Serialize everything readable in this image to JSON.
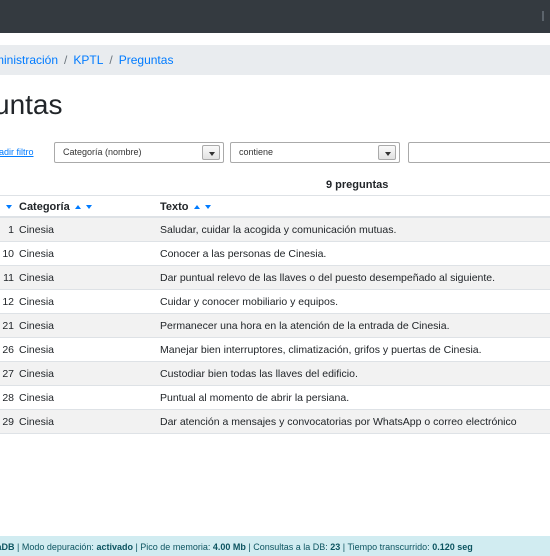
{
  "breadcrumb": {
    "items": [
      "ministración",
      "KPTL",
      "Preguntas"
    ],
    "separator": "/"
  },
  "page_title": "untas",
  "filters": {
    "add_filter_label": "ñadir filtro",
    "field_select": "Categoría (nombre)",
    "operator_select": "contiene",
    "value": ""
  },
  "result_count": "9 preguntas",
  "table": {
    "headers": {
      "categoria": "Categoría",
      "texto": "Texto"
    },
    "rows": [
      {
        "id": "1",
        "categoria": "Cinesia",
        "texto": "Saludar, cuidar la acogida y comunicación mutuas."
      },
      {
        "id": "10",
        "categoria": "Cinesia",
        "texto": "Conocer a las personas de Cinesia."
      },
      {
        "id": "11",
        "categoria": "Cinesia",
        "texto": "Dar puntual relevo de las llaves o del puesto desempeñado al siguiente."
      },
      {
        "id": "12",
        "categoria": "Cinesia",
        "texto": "Cuidar y conocer mobiliario y equipos."
      },
      {
        "id": "21",
        "categoria": "Cinesia",
        "texto": "Permanecer una hora en la atención de la entrada de Cinesia."
      },
      {
        "id": "26",
        "categoria": "Cinesia",
        "texto": "Manejar bien interruptores, climatización, grifos y puertas de Cinesia."
      },
      {
        "id": "27",
        "categoria": "Cinesia",
        "texto": "Custodiar bien todas las llaves del edificio."
      },
      {
        "id": "28",
        "categoria": "Cinesia",
        "texto": "Puntual al momento de abrir la persiana."
      },
      {
        "id": "29",
        "categoria": "Cinesia",
        "texto": "Dar atención a mensajes y convocatorias por WhatsApp o correo electrónico"
      }
    ]
  },
  "footer": {
    "db": "iaDB",
    "debug_label": "Modo depuración:",
    "debug_value": "activado",
    "memory_label": "Pico de memoria:",
    "memory_value": "4.00 Mb",
    "queries_label": "Consultas a la DB:",
    "queries_value": "23",
    "time_label": "Tiempo transcurrido:",
    "time_value": "0.120 seg"
  },
  "colors": {
    "topbar": "#343a40",
    "link": "#007bff",
    "footer_bg": "#d1ecf1",
    "row_stripe": "#f2f2f2"
  }
}
